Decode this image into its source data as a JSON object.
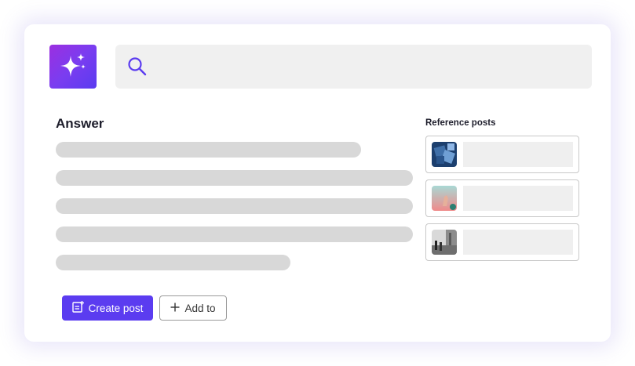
{
  "search": {
    "placeholder": ""
  },
  "answer": {
    "title": "Answer"
  },
  "references": {
    "title": "Reference posts",
    "items": [
      {
        "thumb": "blue-abstract-image"
      },
      {
        "thumb": "pink-hand-image"
      },
      {
        "thumb": "grayscale-street-image"
      }
    ]
  },
  "actions": {
    "create_post_label": "Create post",
    "add_to_label": "Add to"
  },
  "colors": {
    "accent": "#5b3cf0",
    "logo_gradient_start": "#9b2fe0",
    "logo_gradient_end": "#5a3bf0",
    "skeleton": "#d8d8d8",
    "placeholder": "#efefef"
  },
  "icons": {
    "logo": "sparkles-icon",
    "search": "search-icon",
    "create_post": "note-plus-icon",
    "add_to": "plus-icon"
  }
}
